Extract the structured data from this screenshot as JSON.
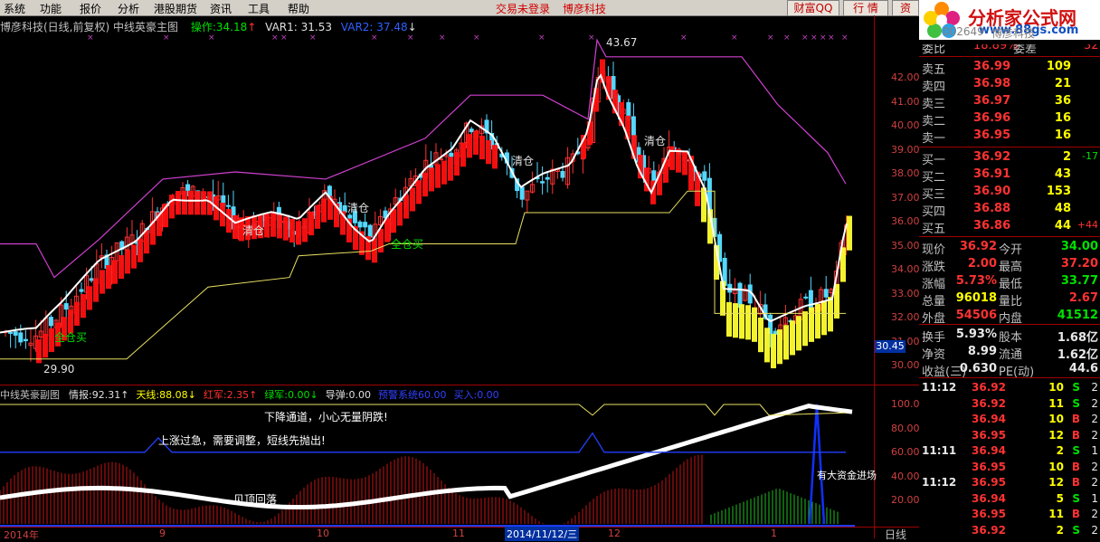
{
  "menu": [
    "系统",
    "功能",
    "报价",
    "分析",
    "港股期货",
    "资讯",
    "工具",
    "帮助"
  ],
  "status_center": [
    "交易未登录",
    "博彦科技"
  ],
  "right_buttons": [
    "财富QQ",
    "行 情",
    "资"
  ],
  "logo": {
    "title": "分析家公式网",
    "url": "www.88gs.com"
  },
  "chart_title": {
    "name": "博彦科技(日线,前复权) 中线英豪主图",
    "op_label": "操作:",
    "op_value": "34.18",
    "var1": "VAR1: 31.53",
    "var2": "VAR2: 37.48"
  },
  "price_axis": [
    "42.00",
    "41.00",
    "40.00",
    "39.00",
    "38.00",
    "37.00",
    "36.00",
    "35.00",
    "34.00",
    "33.00",
    "32.00",
    "31.00",
    "30.00"
  ],
  "current_price_tag": "30.45",
  "annotations": {
    "high": "43.67",
    "low": "29.90",
    "buy1": "全仓买",
    "buy2": "全仓买",
    "clear1": "清仓",
    "clear2": "清仓",
    "clear3": "清仓",
    "clear4": "清仓"
  },
  "sub_chart": {
    "title": "中线英豪副图",
    "items": [
      {
        "label": "情报:",
        "value": "92.31",
        "arrow": "↑",
        "color": "#e0e0e0"
      },
      {
        "label": "天线:",
        "value": "88.08",
        "arrow": "↓",
        "color": "#ffff00"
      },
      {
        "label": "红军:",
        "value": "2.35",
        "arrow": "↑",
        "color": "#ff3232"
      },
      {
        "label": "绿军:",
        "value": "0.00",
        "arrow": "↓",
        "color": "#00e000"
      },
      {
        "label": "导弹:",
        "value": "0.00",
        "arrow": "",
        "color": "#e0e0e0"
      },
      {
        "label": "预警系统",
        "value": "60.00",
        "arrow": "",
        "color": "#3040ff"
      },
      {
        "label": "买入:",
        "value": "0.00",
        "arrow": "",
        "color": "#3040ff"
      }
    ],
    "axis": [
      "100.0",
      "80.00",
      "60.00",
      "40.00",
      "20.00"
    ],
    "notes": {
      "down": "下降通道，小心无量阴跌!",
      "up": "上涨过急，需要调整，短线先抛出!",
      "top": "见顶回落",
      "fund": "有大资金进场"
    }
  },
  "date_axis": [
    "2014年",
    "9",
    "10",
    "11",
    "2014/11/12/三",
    "12",
    "1"
  ],
  "period_label": "日线",
  "quote": {
    "code": "002649",
    "name": "博彦科技",
    "weibi": {
      "label": "委比",
      "value": "18.89%",
      "label2": "委差",
      "value2": "32"
    },
    "sell": [
      {
        "label": "卖五",
        "price": "36.99",
        "vol": "109"
      },
      {
        "label": "卖四",
        "price": "36.98",
        "vol": "21"
      },
      {
        "label": "卖三",
        "price": "36.97",
        "vol": "36"
      },
      {
        "label": "卖二",
        "price": "36.96",
        "vol": "16"
      },
      {
        "label": "卖一",
        "price": "36.95",
        "vol": "16"
      }
    ],
    "buy": [
      {
        "label": "买一",
        "price": "36.92",
        "vol": "2",
        "chg": "-17"
      },
      {
        "label": "买二",
        "price": "36.91",
        "vol": "43",
        "chg": ""
      },
      {
        "label": "买三",
        "price": "36.90",
        "vol": "153",
        "chg": ""
      },
      {
        "label": "买四",
        "price": "36.88",
        "vol": "48",
        "chg": ""
      },
      {
        "label": "买五",
        "price": "36.86",
        "vol": "44",
        "chg": "+44"
      }
    ],
    "stats": [
      {
        "l1": "现价",
        "v1": "36.92",
        "l2": "今开",
        "v2": "34.00"
      },
      {
        "l1": "涨跌",
        "v1": "2.00",
        "l2": "最高",
        "v2": "37.20"
      },
      {
        "l1": "涨幅",
        "v1": "5.73%",
        "l2": "最低",
        "v2": "33.77"
      },
      {
        "l1": "总量",
        "v1": "96018",
        "l2": "量比",
        "v2": "2.67"
      },
      {
        "l1": "外盘",
        "v1": "54506",
        "l2": "内盘",
        "v2": "41512"
      }
    ],
    "stats2": [
      {
        "l1": "换手",
        "v1": "5.93%",
        "l2": "股本",
        "v2": "1.68亿"
      },
      {
        "l1": "净资",
        "v1": "8.99",
        "l2": "流通",
        "v2": "1.62亿"
      },
      {
        "l1": "收益(三)",
        "v1": "0.630",
        "l2": "PE(动)",
        "v2": "44.6"
      }
    ],
    "ticks": [
      {
        "t": "11:12",
        "p": "36.92",
        "v": "10",
        "s": "S",
        "n": "2"
      },
      {
        "t": "",
        "p": "36.92",
        "v": "11",
        "s": "S",
        "n": "2"
      },
      {
        "t": "",
        "p": "36.94",
        "v": "10",
        "s": "B",
        "n": "2"
      },
      {
        "t": "",
        "p": "36.95",
        "v": "12",
        "s": "B",
        "n": "2"
      },
      {
        "t": "11:11",
        "p": "36.94",
        "v": "2",
        "s": "S",
        "n": "1"
      },
      {
        "t": "",
        "p": "36.95",
        "v": "10",
        "s": "B",
        "n": "2"
      },
      {
        "t": "11:12",
        "p": "36.95",
        "v": "12",
        "s": "B",
        "n": "2"
      },
      {
        "t": "",
        "p": "36.94",
        "v": "5",
        "s": "S",
        "n": "1"
      },
      {
        "t": "",
        "p": "36.95",
        "v": "11",
        "s": "B",
        "n": "2"
      },
      {
        "t": "",
        "p": "36.92",
        "v": "2",
        "s": "S",
        "n": "2"
      }
    ]
  }
}
